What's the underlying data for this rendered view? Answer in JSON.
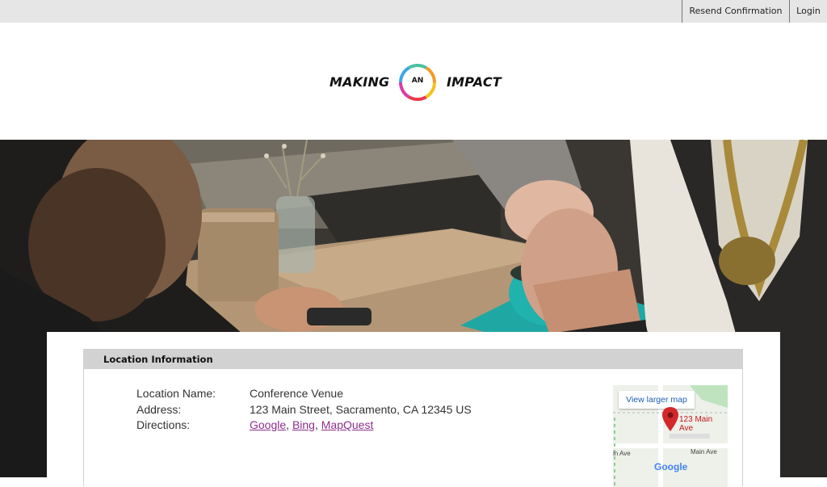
{
  "topbar": {
    "resend_label": "Resend Confirmation",
    "login_label": "Login"
  },
  "logo": {
    "word_left": "MAKING",
    "word_middle": "AN",
    "word_right": "IMPACT"
  },
  "hero": {
    "image": "photo of two people shaking hands across a cafe table"
  },
  "location": {
    "section_title": "Location Information",
    "fields": {
      "name_label": "Location Name:",
      "name_value": "Conference Venue",
      "address_label": "Address:",
      "address_value": "123 Main Street, Sacramento, CA 12345 US",
      "directions_label": "Directions:",
      "links": [
        "Google",
        "Bing",
        "MapQuest"
      ],
      "separator": ", "
    },
    "map": {
      "larger_map_label": "View larger map",
      "pin_label": "123 Main Ave",
      "street_left": "in Ave",
      "street_right": "Main Ave",
      "provider": "Google"
    }
  },
  "colors": {
    "topbar_bg": "#e6e6e6",
    "panel_header_bg": "#d2d2d2",
    "link": "#8e2f8e",
    "map_pin": "#c2181b"
  }
}
